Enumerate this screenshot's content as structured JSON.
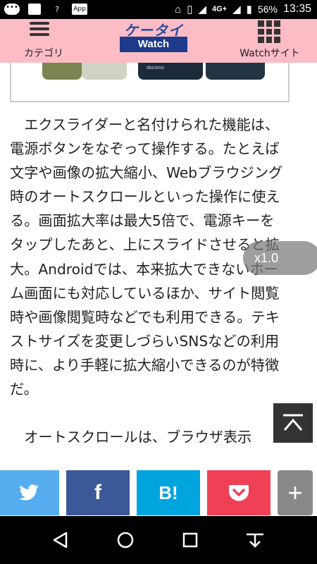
{
  "status_bar": {
    "app_badge": "App",
    "network": "4G+",
    "battery_percent": "56%",
    "time": "13:35"
  },
  "header": {
    "category_label": "カテゴリ",
    "logo_top": "ケータイ",
    "logo_bottom": "Watch",
    "site_label": "Watchサイト"
  },
  "article": {
    "image_caption": "docomo",
    "paragraphs": [
      "エクスライダーと名付けられた機能は、電源ボタンをなぞって操作する。たとえば文字や画像の拡大縮小、Webブラウジング時のオートスクロールといった操作に使える。画面拡大率は最大5倍で、電源キーをタップしたあと、上にスライドさせると拡大。Androidでは、本来拡大できないホーム画面にも対応しているほか、サイト閲覧時や画像閲覧時などでも利用できる。テキストサイズを変更しづらいSNSなどの利用時に、より手軽に拡大縮小できるのが特徴だ。",
      "オートスクロールは、ブラウザ表示"
    ]
  },
  "zoom_badge": "x1.0",
  "share": {
    "facebook_label": "f",
    "hatena_label": "B!",
    "more_label": "+"
  },
  "colors": {
    "header_bg": "#fbbcc6",
    "twitter": "#55acee",
    "facebook": "#3b5998",
    "hatena": "#00a4de",
    "pocket": "#ef4056"
  }
}
